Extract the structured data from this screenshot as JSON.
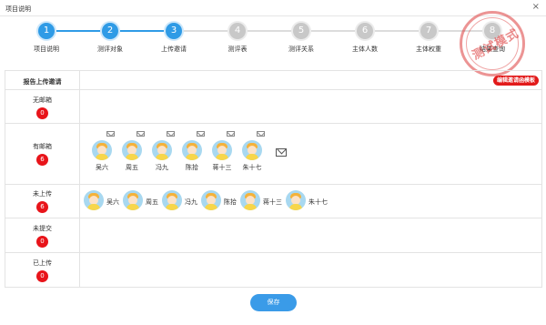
{
  "window": {
    "title": "项目说明",
    "close_label": "×"
  },
  "stepper": {
    "steps": [
      {
        "number": "1",
        "label": "项目说明",
        "state": "active"
      },
      {
        "number": "2",
        "label": "测评对象",
        "state": "active"
      },
      {
        "number": "3",
        "label": "上传邀请",
        "state": "active"
      },
      {
        "number": "4",
        "label": "测评表",
        "state": "inactive"
      },
      {
        "number": "5",
        "label": "测评关系",
        "state": "inactive"
      },
      {
        "number": "6",
        "label": "主体人数",
        "state": "inactive"
      },
      {
        "number": "7",
        "label": "主体权重",
        "state": "inactive"
      },
      {
        "number": "8",
        "label": "结果查询",
        "state": "inactive"
      }
    ]
  },
  "stamp": {
    "text": "测试模式"
  },
  "table": {
    "header_label": "报告上传邀请",
    "template_button": "编辑邀请函模板",
    "rows": [
      {
        "label": "无邮箱",
        "count": "0"
      },
      {
        "label": "有邮箱",
        "count": "6"
      },
      {
        "label": "未上传",
        "count": "6"
      },
      {
        "label": "未提交",
        "count": "0"
      },
      {
        "label": "已上传",
        "count": "0"
      }
    ],
    "with_email_people": [
      "吴六",
      "周五",
      "冯九",
      "陈拾",
      "蒋十三",
      "朱十七"
    ],
    "not_uploaded_people": [
      "吴六",
      "周五",
      "冯九",
      "陈拾",
      "蒋十三",
      "朱十七"
    ]
  },
  "footer": {
    "save_label": "保存"
  },
  "colors": {
    "accent": "#2f9be6",
    "badge": "#e8141a",
    "stamp": "#dc3c3c"
  }
}
